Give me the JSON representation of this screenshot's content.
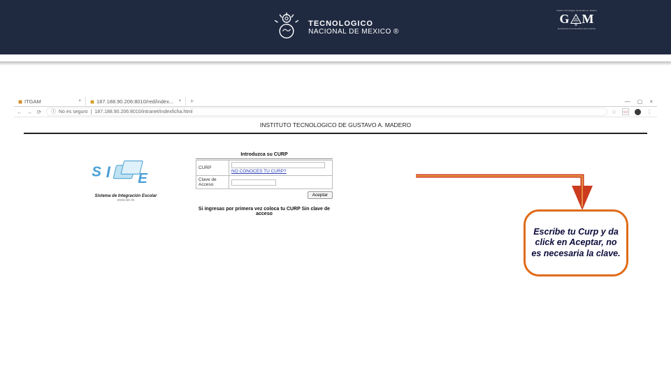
{
  "banner": {
    "tecnm_line1": "TECNOLOGICO",
    "tecnm_line2": "NACIONAL DE MEXICO ®",
    "gam_main": "GAM",
    "gam_top": "Instituto Tecnológico de Gustavo A. Madero",
    "gam_bottom": "Excelencia en la educación de la ciencia"
  },
  "tabs": {
    "tab1_label": "ITGAM",
    "tab2_label": "187.188.90.206:8010/red/index...",
    "close_glyph": "×",
    "plus_glyph": "+",
    "min_glyph": "—",
    "max_glyph": "▢",
    "winclose_glyph": "×"
  },
  "addr": {
    "back": "←",
    "fwd": "→",
    "reload": "⟳",
    "insecure_icon": "ⓘ",
    "insecure_text": "No es seguro",
    "sep": "|",
    "url": "187.188.90.206:8010/intranet/indexficha.html",
    "star": "☆",
    "shield": "▭",
    "dots": "⋮"
  },
  "page": {
    "title": "INSTITUTO TECNOLOGICO DE GUSTAVO A. MADERO",
    "sie_letters": "S I E",
    "sie_text": "Sistema de Integración Escolar",
    "sie_sub": "www.sie.itx"
  },
  "form": {
    "heading": "Introduzca su CURP",
    "curp_label": "CURP",
    "no_curp_link": "NO CONOCES TU CURP?",
    "clave_label": "Clave de Acceso",
    "curp_value": "",
    "clave_value": "",
    "submit": "Aceptar",
    "first_time": "Si ingresas por primera vez coloca tu CURP Sin clave de acceso"
  },
  "callout": {
    "text": "Escribe tu Curp y da click en Aceptar, no es necesaria la clave."
  }
}
